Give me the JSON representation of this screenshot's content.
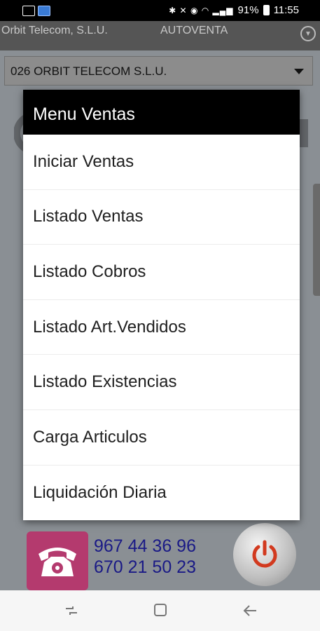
{
  "status_bar": {
    "battery": "91%",
    "time": "11:55"
  },
  "app_header": {
    "company": "Orbit Telecom, S.L.U.",
    "app_name": "AUTOVENTA"
  },
  "company_select": {
    "value": "026 ORBIT TELECOM S.L.U."
  },
  "dialog": {
    "title": "Menu Ventas",
    "items": [
      {
        "label": "Iniciar Ventas"
      },
      {
        "label": "Listado Ventas"
      },
      {
        "label": "Listado Cobros"
      },
      {
        "label": "Listado Art.Vendidos"
      },
      {
        "label": "Listado Existencias"
      },
      {
        "label": "Carga Articulos"
      },
      {
        "label": "Liquidación Diaria"
      }
    ]
  },
  "contact": {
    "phone_1": "967 44 36 96",
    "phone_2": "670 21 50 23"
  },
  "icons": {
    "phone": "phone-icon",
    "power": "power-icon",
    "nav_recents": "recents-icon",
    "nav_home": "home-icon",
    "nav_back": "back-icon"
  },
  "colors": {
    "dialog_title_bg": "#000000",
    "phone_tile": "#b43a6e",
    "phone_text": "#1a1a86",
    "power_symbol": "#d23a1f"
  }
}
